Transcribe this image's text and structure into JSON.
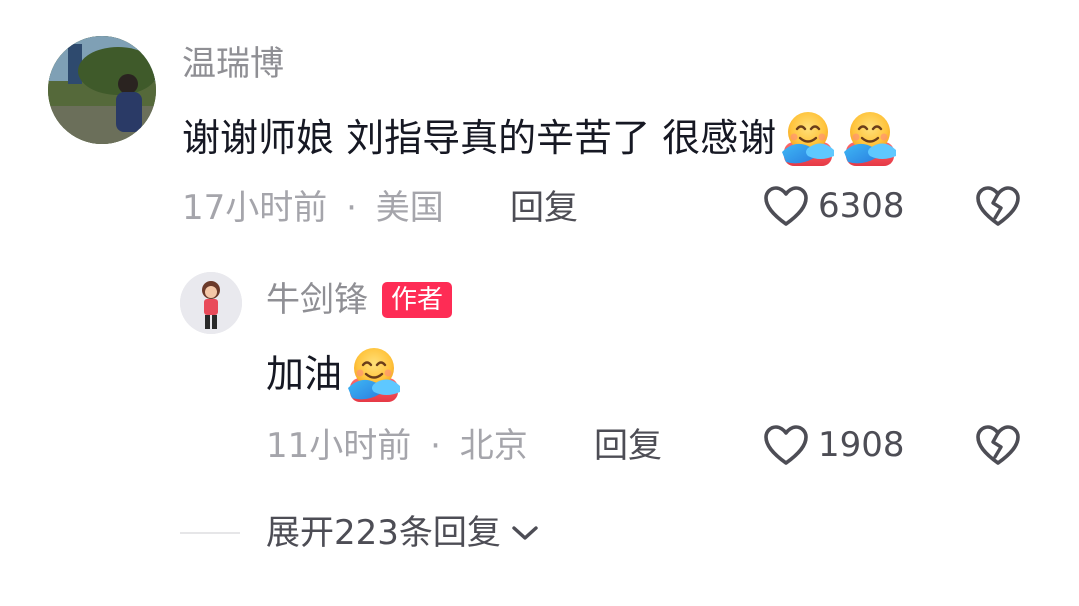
{
  "comment": {
    "username": "温瑞博",
    "text": "谢谢师娘 刘指导真的辛苦了 很感谢",
    "emojis": [
      "hugging-face-icon",
      "hugging-face-icon"
    ],
    "time": "17小时前",
    "separator": "·",
    "location": "美国",
    "reply_label": "回复",
    "likes": "6308"
  },
  "reply": {
    "username": "牛剑锋",
    "author_badge": "作者",
    "text": "加油",
    "emojis": [
      "hugging-face-icon"
    ],
    "time": "11小时前",
    "separator": "·",
    "location": "北京",
    "reply_label": "回复",
    "likes": "1908"
  },
  "expand": {
    "label": "展开223条回复"
  },
  "colors": {
    "badge": "#fe2c55",
    "username": "#8f8f94",
    "text": "#161823",
    "meta": "#a5a5ab"
  }
}
